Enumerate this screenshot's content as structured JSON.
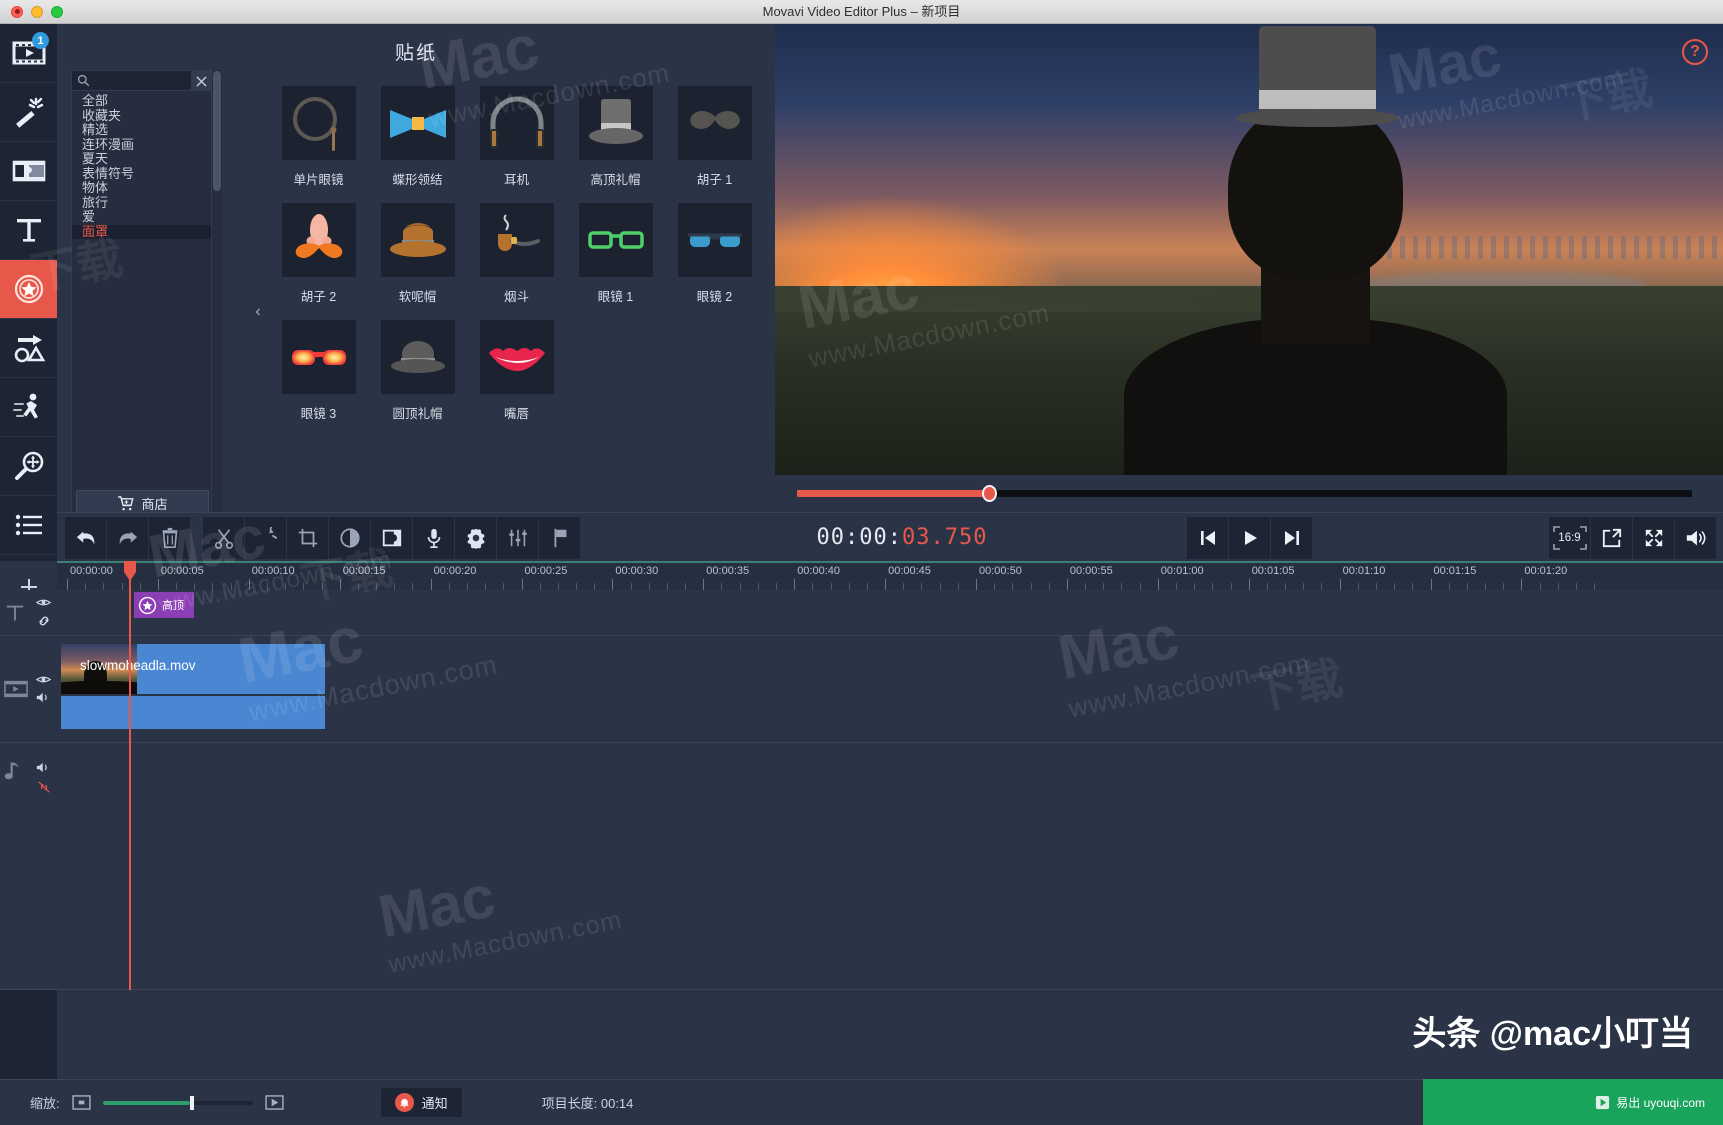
{
  "window": {
    "title": "Movavi Video Editor Plus – 新项目",
    "traffic_lights": [
      "close",
      "minimize",
      "maximize"
    ]
  },
  "rail": {
    "items": [
      {
        "name": "import",
        "icon": "film-play-icon",
        "badge": "1",
        "active": false
      },
      {
        "name": "filters",
        "icon": "magic-wand-icon",
        "badge": "",
        "active": false
      },
      {
        "name": "transitions",
        "icon": "transition-icon",
        "badge": "",
        "active": false
      },
      {
        "name": "titles",
        "icon": "text-t-icon",
        "badge": "",
        "active": false
      },
      {
        "name": "stickers",
        "icon": "sticker-star-icon",
        "badge": "",
        "active": true
      },
      {
        "name": "callouts",
        "icon": "shapes-arrow-icon",
        "badge": "",
        "active": false
      },
      {
        "name": "animation",
        "icon": "running-man-icon",
        "badge": "",
        "active": false
      },
      {
        "name": "pan-zoom",
        "icon": "magnifier-move-icon",
        "badge": "",
        "active": false
      },
      {
        "name": "more-tools",
        "icon": "list-icon",
        "badge": "",
        "active": false
      }
    ]
  },
  "panel": {
    "title": "贴纸",
    "search": {
      "placeholder": "",
      "value": "",
      "clear_label": "✕"
    },
    "categories": [
      "全部",
      "收藏夹",
      "精选",
      "连环漫画",
      "夏天",
      "表情符号",
      "物体",
      "旅行",
      "爱",
      "面罩"
    ],
    "selected_category": "面罩",
    "store_button": "商店",
    "collapse_label": "‹",
    "stickers": [
      {
        "label": "单片眼镜",
        "icon": "monocle"
      },
      {
        "label": "蝶形领结",
        "icon": "bowtie"
      },
      {
        "label": "耳机",
        "icon": "headphones"
      },
      {
        "label": "高顶礼帽",
        "icon": "tophat"
      },
      {
        "label": "胡子 1",
        "icon": "mustache1"
      },
      {
        "label": "胡子 2",
        "icon": "mustache2"
      },
      {
        "label": "软呢帽",
        "icon": "fedora"
      },
      {
        "label": "烟斗",
        "icon": "pipe"
      },
      {
        "label": "眼镜 1",
        "icon": "glasses-green"
      },
      {
        "label": "眼镜 2",
        "icon": "glasses-blue"
      },
      {
        "label": "眼镜 3",
        "icon": "glasses-red"
      },
      {
        "label": "圆顶礼帽",
        "icon": "bowler"
      },
      {
        "label": "嘴唇",
        "icon": "lips"
      }
    ]
  },
  "preview": {
    "help_label": "?",
    "seek_percent": 21.4
  },
  "controlbar": {
    "left_tools": [
      {
        "name": "undo",
        "icon": "undo-arrow-icon"
      },
      {
        "name": "redo",
        "icon": "redo-arrow-icon"
      },
      {
        "name": "delete",
        "icon": "trash-icon"
      },
      {
        "name": "cut",
        "icon": "scissors-icon"
      },
      {
        "name": "rotate",
        "icon": "rotate-icon"
      },
      {
        "name": "crop",
        "icon": "crop-icon"
      },
      {
        "name": "color-adjust",
        "icon": "contrast-circle-icon"
      },
      {
        "name": "transition",
        "icon": "transition-square-icon"
      },
      {
        "name": "record-audio",
        "icon": "microphone-icon"
      },
      {
        "name": "clip-properties",
        "icon": "gear-icon"
      },
      {
        "name": "audio-mixer",
        "icon": "sliders-icon"
      },
      {
        "name": "marker",
        "icon": "flag-icon"
      }
    ],
    "timecode": {
      "hms": "00:00:",
      "ms": "03.750"
    },
    "playback": [
      {
        "name": "previous-frame",
        "icon": "skip-back-icon"
      },
      {
        "name": "play",
        "icon": "play-icon"
      },
      {
        "name": "next-frame",
        "icon": "skip-forward-icon"
      }
    ],
    "right_tools": [
      {
        "name": "aspect-ratio",
        "label": "16:9"
      },
      {
        "name": "export-preview",
        "icon": "export-icon"
      },
      {
        "name": "fullscreen",
        "icon": "fullscreen-icon"
      },
      {
        "name": "volume",
        "icon": "speaker-icon"
      }
    ]
  },
  "timeline": {
    "ticks": [
      "00:00:00",
      "00:00:05",
      "00:00:10",
      "00:00:15",
      "00:00:20",
      "00:00:25",
      "00:00:30",
      "00:00:35",
      "00:00:40",
      "00:00:45",
      "00:00:50",
      "00:00:55",
      "00:01:00",
      "00:01:05",
      "00:01:10",
      "00:01:15",
      "00:01:20"
    ],
    "add_track_label": "+",
    "tracks": [
      {
        "name": "title-track",
        "icon": "text-t-icon",
        "toggles": [
          "eye-icon",
          "link-icon"
        ]
      },
      {
        "name": "video-track",
        "icon": "film-icon",
        "toggles": [
          "eye-icon",
          "speaker-icon"
        ]
      },
      {
        "name": "audio-track",
        "icon": "music-note-icon",
        "toggles": [
          "speaker-icon",
          "unlink-icon"
        ]
      }
    ],
    "sticker_clip": {
      "label": "高顶",
      "icon": "sticker-star-icon"
    },
    "video_clip": {
      "label": "slowmoheadla.mov"
    }
  },
  "statusbar": {
    "zoom_label": "缩放:",
    "zoom_out_icon": "zoom-out-frame-icon",
    "zoom_in_icon": "zoom-in-frame-icon",
    "zoom_percent": 58,
    "notify_label": "通知",
    "project_length": "项目长度:  00:14"
  },
  "watermarks": {
    "mac_text": "Mac",
    "mac_sub": "www.Macdown.com",
    "cn_text": "下载",
    "toutiao": "头条 @mac小叮当",
    "taskbar": "易出 uyouqi.com"
  },
  "colors": {
    "accent_red": "#e8584a",
    "panel_bg": "#2b3447",
    "rail_bg": "#1d2433",
    "clip_blue": "#4a87d3",
    "sticker_purple": "#8c3fb5",
    "track_green": "#3b7f72",
    "zoom_green": "#2e9e6b"
  }
}
